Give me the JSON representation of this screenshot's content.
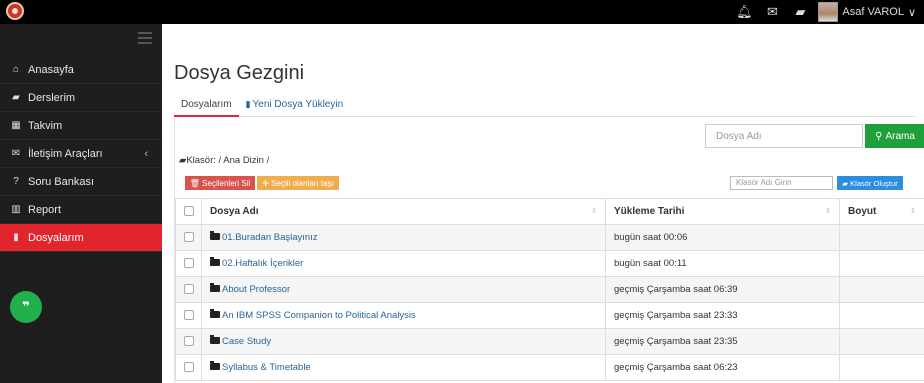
{
  "header": {
    "user_name": "Asaf VAROL",
    "icons": [
      "bell-icon",
      "mail-icon",
      "book-icon"
    ]
  },
  "sidebar": {
    "items": [
      {
        "icon": "home-icon",
        "glyph": "⌂",
        "label": "Anasayfa"
      },
      {
        "icon": "book-icon",
        "glyph": "▰",
        "label": "Derslerim"
      },
      {
        "icon": "calendar-icon",
        "glyph": "▦",
        "label": "Takvim"
      },
      {
        "icon": "mail-icon",
        "glyph": "✉",
        "label": "İletişim Araçları"
      },
      {
        "icon": "question-icon",
        "glyph": "?",
        "label": "Soru Bankası"
      },
      {
        "icon": "report-icon",
        "glyph": "▥",
        "label": "Report"
      },
      {
        "icon": "file-icon",
        "glyph": "▮",
        "label": "Dosyalarım"
      }
    ],
    "active": "Dosyalarım"
  },
  "page": {
    "title": "Dosya Gezgini",
    "tabs": [
      "Dosyalarım",
      "Yeni Dosya Yükleyin"
    ]
  },
  "search": {
    "placeholder": "Dosya Adı",
    "button": "Arama"
  },
  "folder_path": "Klasör: / Ana Dizin /",
  "actions": {
    "delete": "Seçilenleri Sil",
    "move": "Seçili olanları taşı",
    "folder_placeholder": "Klasör Adı Girin",
    "create": "Klasör Oluştur"
  },
  "table": {
    "headers": [
      "Dosya Adı",
      "Yükleme Tarihi",
      "Boyut"
    ],
    "rows": [
      {
        "name": "01.Buradan Başlayınız",
        "date": "bugün saat 00:06",
        "size": ""
      },
      {
        "name": "02.Haftalık İçerikler",
        "date": "bugün saat 00:11",
        "size": ""
      },
      {
        "name": "About Professor",
        "date": "geçmiş Çarşamba saat 06:39",
        "size": ""
      },
      {
        "name": "An IBM SPSS Companion to Political Analysis",
        "date": "geçmiş Çarşamba saat 23:33",
        "size": ""
      },
      {
        "name": "Case Study",
        "date": "geçmiş Çarşamba saat 23:35",
        "size": ""
      },
      {
        "name": "Syllabus & Timetable",
        "date": "geçmiş Çarşamba saat 06:23",
        "size": ""
      }
    ]
  },
  "colors": {
    "accent_red": "#e2252c",
    "search_green": "#1fa03a",
    "create_blue": "#2d8ee0",
    "link_blue": "#2a6496"
  }
}
